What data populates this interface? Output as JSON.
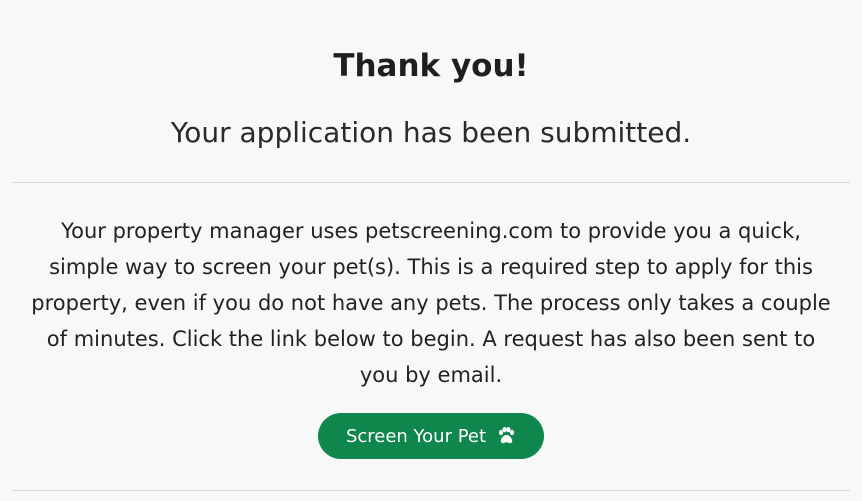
{
  "confirmation": {
    "title": "Thank you!",
    "subtitle": "Your application has been submitted.",
    "message": "Your property manager uses petscreening.com to provide you a quick, simple way to screen your pet(s). This is a required step to apply for this property, even if you do not have any pets. The process only takes a couple of minutes. Click the link below to begin. A request has also been sent to you by email."
  },
  "cta": {
    "label": "Screen Your Pet",
    "icon": "paw-icon"
  },
  "colors": {
    "accent": "#0f864b",
    "background": "#f8f8f8",
    "text": "#222222",
    "divider": "#d9d9d9"
  }
}
